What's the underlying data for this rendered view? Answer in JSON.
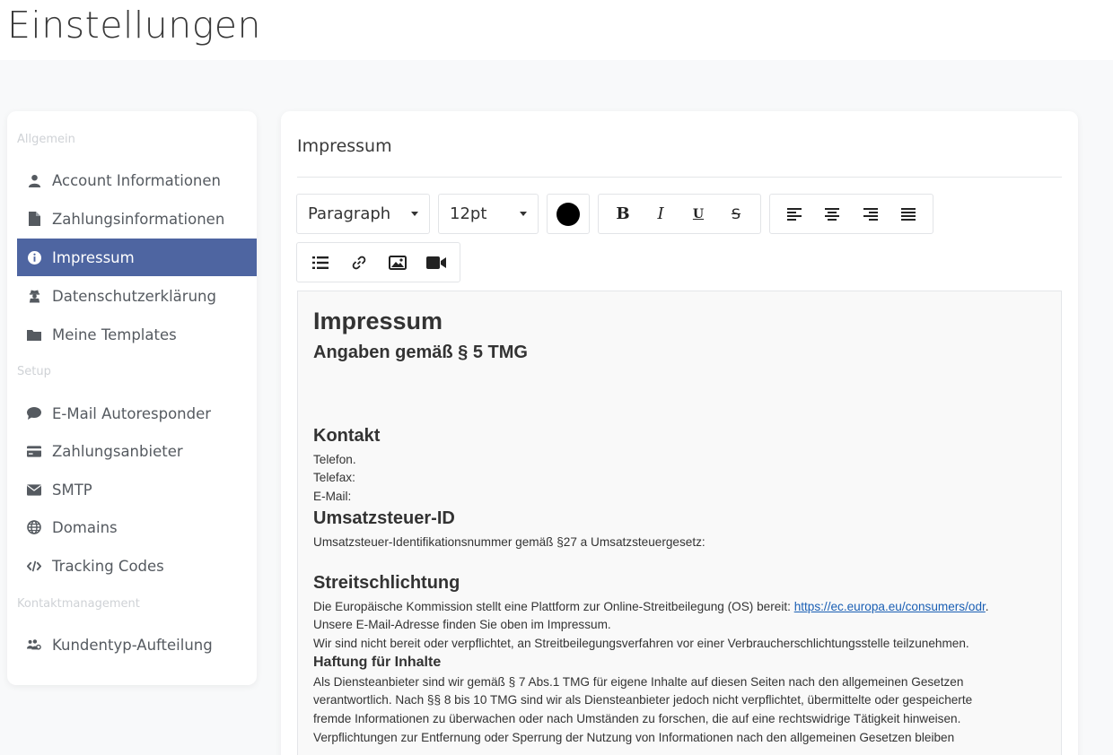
{
  "page": {
    "title": "Einstellungen"
  },
  "sidebar": {
    "sections": {
      "allgemein": "Allgemein",
      "setup": "Setup",
      "kontakt": "Kontaktmanagement"
    },
    "items": [
      {
        "label": "Account Informationen",
        "icon": "user-icon"
      },
      {
        "label": "Zahlungsinformationen",
        "icon": "file-icon"
      },
      {
        "label": "Impressum",
        "icon": "info-circle-icon",
        "active": true
      },
      {
        "label": "Datenschutzerklärung",
        "icon": "user-secret-icon"
      },
      {
        "label": "Meine Templates",
        "icon": "folder-icon"
      },
      {
        "label": "E-Mail Autoresponder",
        "icon": "comment-icon"
      },
      {
        "label": "Zahlungsanbieter",
        "icon": "credit-card-icon"
      },
      {
        "label": "SMTP",
        "icon": "envelope-icon"
      },
      {
        "label": "Domains",
        "icon": "globe-icon"
      },
      {
        "label": "Tracking Codes",
        "icon": "code-icon"
      },
      {
        "label": "Kundentyp-Aufteilung",
        "icon": "users-cog-icon"
      }
    ]
  },
  "main": {
    "title": "Impressum",
    "toolbar": {
      "format": "Paragraph",
      "size": "12pt",
      "text_color": "#000000",
      "bold": "B",
      "italic": "I",
      "underline": "U",
      "strike": "S"
    },
    "editor": {
      "h1": "Impressum",
      "h2": "Angaben gemäß § 5 TMG",
      "kontakt_heading": "Kontakt",
      "telefon": "Telefon.",
      "telefax": "Telefax:",
      "email": "E-Mail:",
      "ust_heading": "Umsatzsteuer-ID",
      "ust_text": "Umsatzsteuer-Identifikationsnummer gemäß §27 a Umsatzsteuergesetz:",
      "streit_heading": "Streitschlichtung",
      "streit_1": "Die Europäische Kommission stellt eine Plattform zur Online-Streitbeilegung (OS) bereit: ",
      "streit_link": "https://ec.europa.eu/consumers/odr",
      "streit_1_end": ".",
      "streit_2": "Unsere E-Mail-Adresse finden Sie oben im Impressum.",
      "streit_3": "Wir sind nicht bereit oder verpflichtet, an Streitbeilegungsverfahren vor einer Verbraucherschlichtungsstelle teilzunehmen.",
      "haftung_heading": "Haftung für Inhalte",
      "haftung_1": "Als Diensteanbieter sind wir gemäß § 7 Abs.1 TMG für eigene Inhalte auf diesen Seiten nach den allgemeinen Gesetzen",
      "haftung_2": "verantwortlich. Nach §§ 8 bis 10 TMG sind wir als Diensteanbieter jedoch nicht verpflichtet, übermittelte oder gespeicherte",
      "haftung_3": "fremde Informationen zu überwachen oder nach Umständen zu forschen, die auf eine rechtswidrige Tätigkeit hinweisen.",
      "haftung_4": "Verpflichtungen zur Entfernung oder Sperrung der Nutzung von Informationen nach den allgemeinen Gesetzen bleiben"
    }
  },
  "colors": {
    "accent": "#4e65a1",
    "link": "#1a5fb4"
  }
}
